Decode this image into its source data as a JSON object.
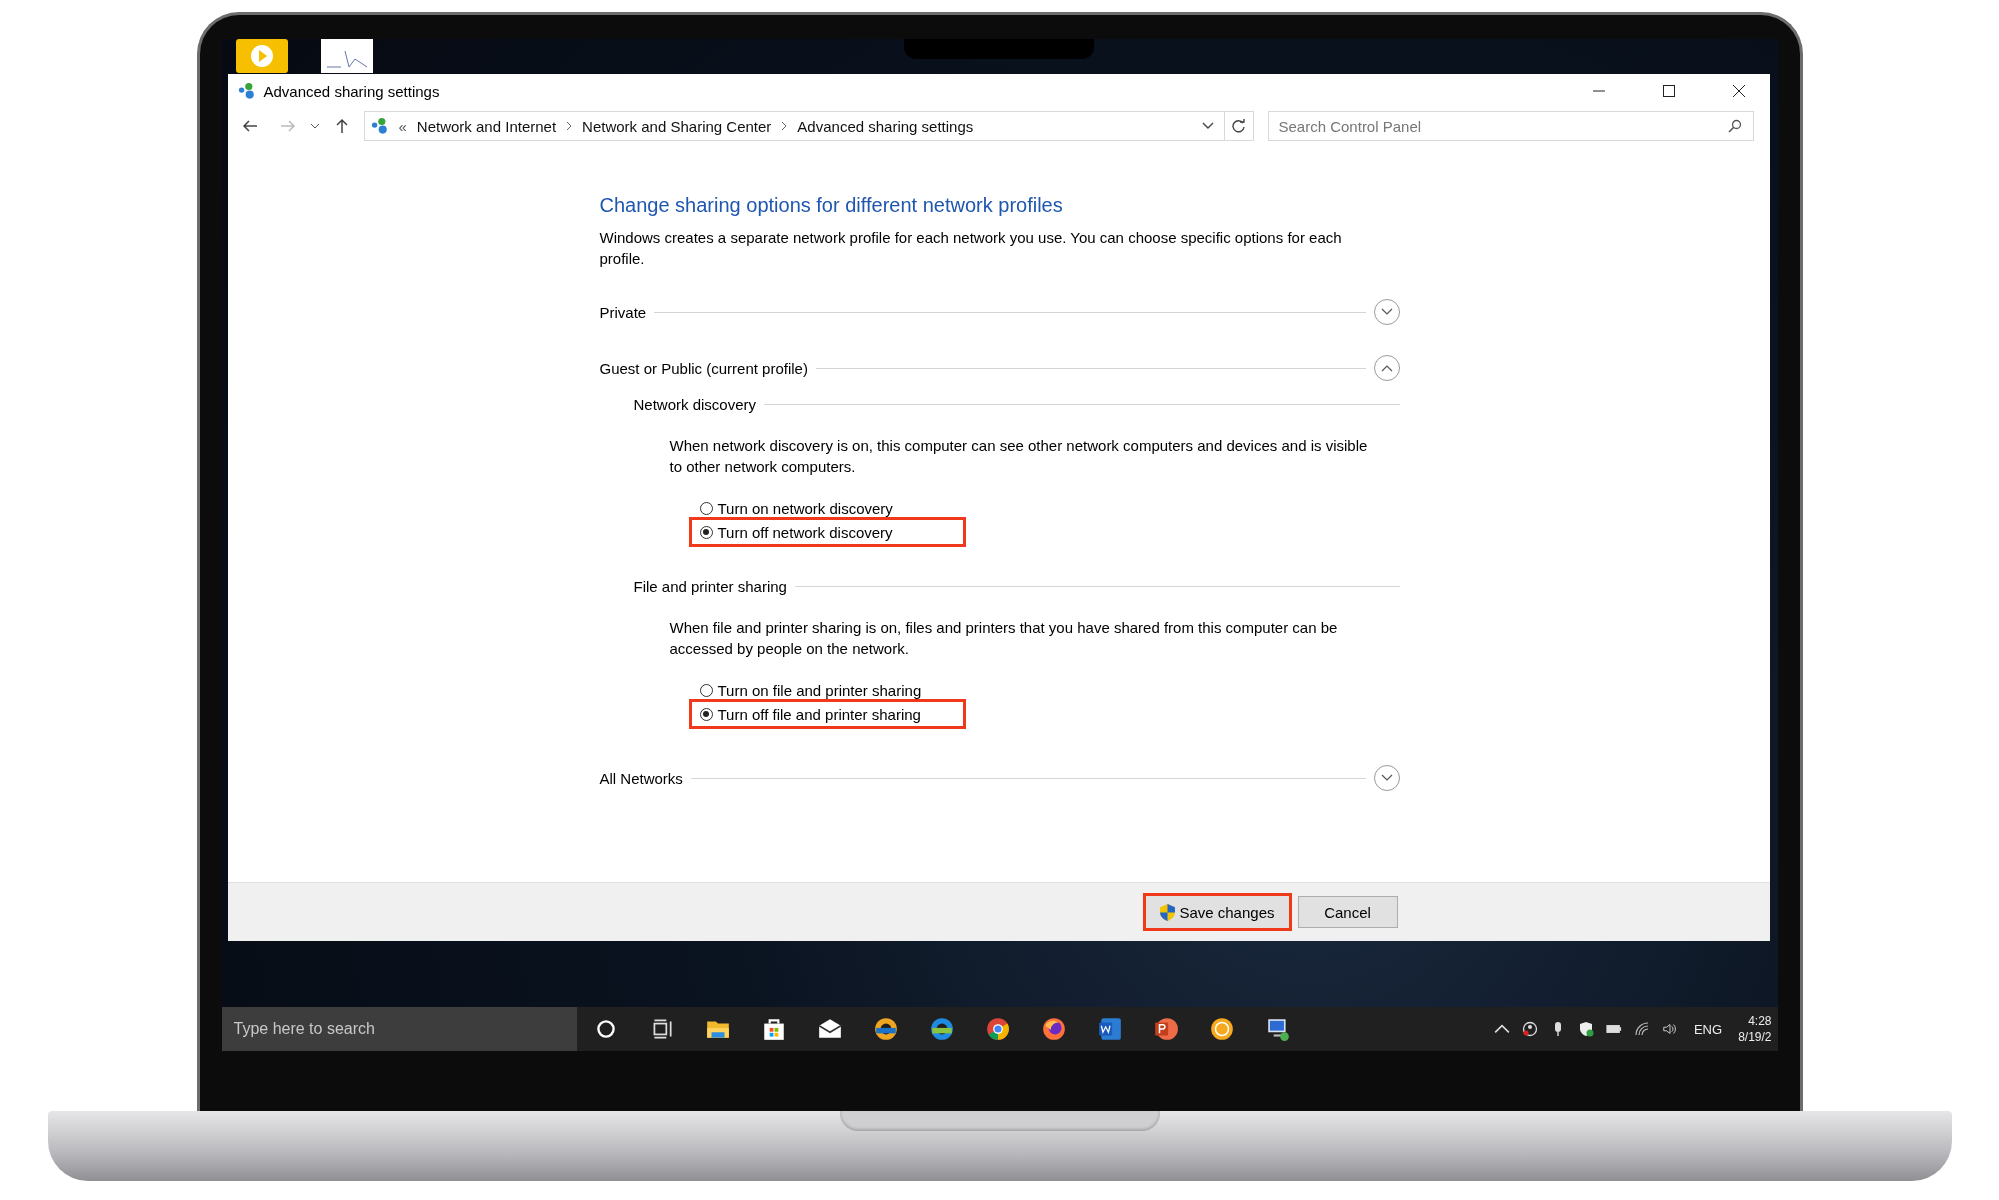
{
  "window": {
    "title": "Advanced sharing settings"
  },
  "address_bar": {
    "overflow": "«",
    "path": [
      "Network and Internet",
      "Network and Sharing Center",
      "Advanced sharing settings"
    ]
  },
  "search": {
    "placeholder": "Search Control Panel"
  },
  "heading": "Change sharing options for different network profiles",
  "intro": "Windows creates a separate network profile for each network you use. You can choose specific options for each profile.",
  "sections": [
    {
      "label": "Private",
      "expanded": false
    },
    {
      "label": "Guest or Public (current profile)",
      "expanded": true,
      "groups": [
        {
          "label": "Network discovery",
          "description": "When network discovery is on, this computer can see other network computers and devices and is visible to other network computers.",
          "options": [
            {
              "label": "Turn on network discovery",
              "selected": false,
              "highlighted": false
            },
            {
              "label": "Turn off network discovery",
              "selected": true,
              "highlighted": true
            }
          ]
        },
        {
          "label": "File and printer sharing",
          "description": "When file and printer sharing is on, files and printers that you have shared from this computer can be accessed by people on the network.",
          "options": [
            {
              "label": "Turn on file and printer sharing",
              "selected": false,
              "highlighted": false
            },
            {
              "label": "Turn off file and printer sharing",
              "selected": true,
              "highlighted": true
            }
          ]
        }
      ]
    },
    {
      "label": "All Networks",
      "expanded": false
    }
  ],
  "buttons": [
    {
      "label": "Save changes",
      "kind": "admin",
      "highlighted": true
    },
    {
      "label": "Cancel",
      "kind": "normal",
      "highlighted": false
    }
  ],
  "taskbar": {
    "search_placeholder": "Type here to search",
    "language": "ENG",
    "time": "4:28",
    "date": "8/19/2"
  }
}
